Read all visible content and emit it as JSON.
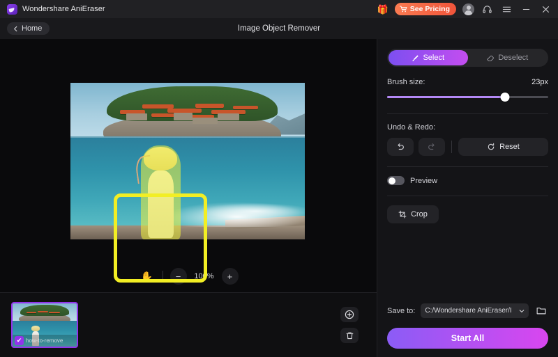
{
  "titlebar": {
    "app_title": "Wondershare AniEraser",
    "logo_icon": "aneraser-logo-icon",
    "gift_icon": "gift-icon",
    "pricing_label": "See Pricing",
    "pricing_icon": "cart-icon",
    "avatar_icon": "user-avatar-icon",
    "support_icon": "headset-icon",
    "menu_icon": "hamburger-menu-icon",
    "minimize_icon": "minimize-icon",
    "close_icon": "close-icon",
    "pricing_color": "#f0543a"
  },
  "subheader": {
    "home_label": "Home",
    "back_icon": "chevron-left-icon",
    "page_title": "Image Object Remover"
  },
  "canvas": {
    "selection_color": "#f2ee24",
    "mask_label": "yellow-selection-mask"
  },
  "zoombar": {
    "pan_icon": "hand-pan-icon",
    "zoom_out_label": "−",
    "zoom_level": "100%",
    "zoom_in_label": "+"
  },
  "filmstrip": {
    "thumbnail_name": "how-to-remove",
    "check_glyph": "✔",
    "add_icon": "plus-circle-icon",
    "delete_icon": "trash-icon",
    "selected_border_color": "#9333ea"
  },
  "panel": {
    "modes": [
      {
        "label": "Select",
        "icon": "brush-icon",
        "active": true
      },
      {
        "label": "Deselect",
        "icon": "eraser-icon",
        "active": false
      }
    ],
    "brush": {
      "label": "Brush size:",
      "value": "23px",
      "percent": 73
    },
    "undo_redo": {
      "label": "Undo & Redo:",
      "undo_icon": "undo-arrow-icon",
      "redo_icon": "redo-arrow-icon",
      "reset_label": "Reset",
      "reset_icon": "reset-circular-arrow-icon"
    },
    "preview": {
      "label": "Preview",
      "enabled": false
    },
    "crop": {
      "label": "Crop",
      "icon": "crop-icon"
    },
    "save": {
      "label": "Save to:",
      "path": "C:/Wondershare AniEraser/I",
      "chevron_icon": "chevron-down-icon",
      "folder_icon": "folder-open-icon"
    },
    "start_label": "Start All",
    "accent_from": "#8b5cf6",
    "accent_to": "#d946ef"
  }
}
